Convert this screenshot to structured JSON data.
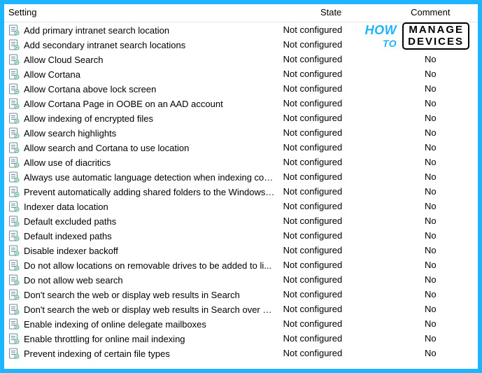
{
  "columns": {
    "setting": "Setting",
    "state": "State",
    "comment": "Comment"
  },
  "rows": [
    {
      "setting": "Add primary intranet search location",
      "state": "Not configured",
      "comment": ""
    },
    {
      "setting": "Add secondary intranet search locations",
      "state": "Not configured",
      "comment": ""
    },
    {
      "setting": "Allow Cloud Search",
      "state": "Not configured",
      "comment": "No"
    },
    {
      "setting": "Allow Cortana",
      "state": "Not configured",
      "comment": "No"
    },
    {
      "setting": "Allow Cortana above lock screen",
      "state": "Not configured",
      "comment": "No"
    },
    {
      "setting": "Allow Cortana Page in OOBE on an AAD account",
      "state": "Not configured",
      "comment": "No"
    },
    {
      "setting": "Allow indexing of encrypted files",
      "state": "Not configured",
      "comment": "No"
    },
    {
      "setting": "Allow search highlights",
      "state": "Not configured",
      "comment": "No"
    },
    {
      "setting": "Allow search and Cortana to use location",
      "state": "Not configured",
      "comment": "No"
    },
    {
      "setting": "Allow use of diacritics",
      "state": "Not configured",
      "comment": "No"
    },
    {
      "setting": "Always use automatic language detection when indexing con...",
      "state": "Not configured",
      "comment": "No"
    },
    {
      "setting": "Prevent automatically adding shared folders to the Windows ...",
      "state": "Not configured",
      "comment": "No"
    },
    {
      "setting": "Indexer data location",
      "state": "Not configured",
      "comment": "No"
    },
    {
      "setting": "Default excluded paths",
      "state": "Not configured",
      "comment": "No"
    },
    {
      "setting": "Default indexed paths",
      "state": "Not configured",
      "comment": "No"
    },
    {
      "setting": "Disable indexer backoff",
      "state": "Not configured",
      "comment": "No"
    },
    {
      "setting": "Do not allow locations on removable drives to be added to li...",
      "state": "Not configured",
      "comment": "No"
    },
    {
      "setting": "Do not allow web search",
      "state": "Not configured",
      "comment": "No"
    },
    {
      "setting": "Don't search the web or display web results in Search",
      "state": "Not configured",
      "comment": "No"
    },
    {
      "setting": "Don't search the web or display web results in Search over m...",
      "state": "Not configured",
      "comment": "No"
    },
    {
      "setting": "Enable indexing of online delegate mailboxes",
      "state": "Not configured",
      "comment": "No"
    },
    {
      "setting": "Enable throttling for online mail indexing",
      "state": "Not configured",
      "comment": "No"
    },
    {
      "setting": "Prevent indexing of certain file types",
      "state": "Not configured",
      "comment": "No"
    }
  ],
  "watermark": {
    "how": "HOW",
    "to": "TO",
    "line1": "MANAGE",
    "line2": "DEVICES"
  }
}
